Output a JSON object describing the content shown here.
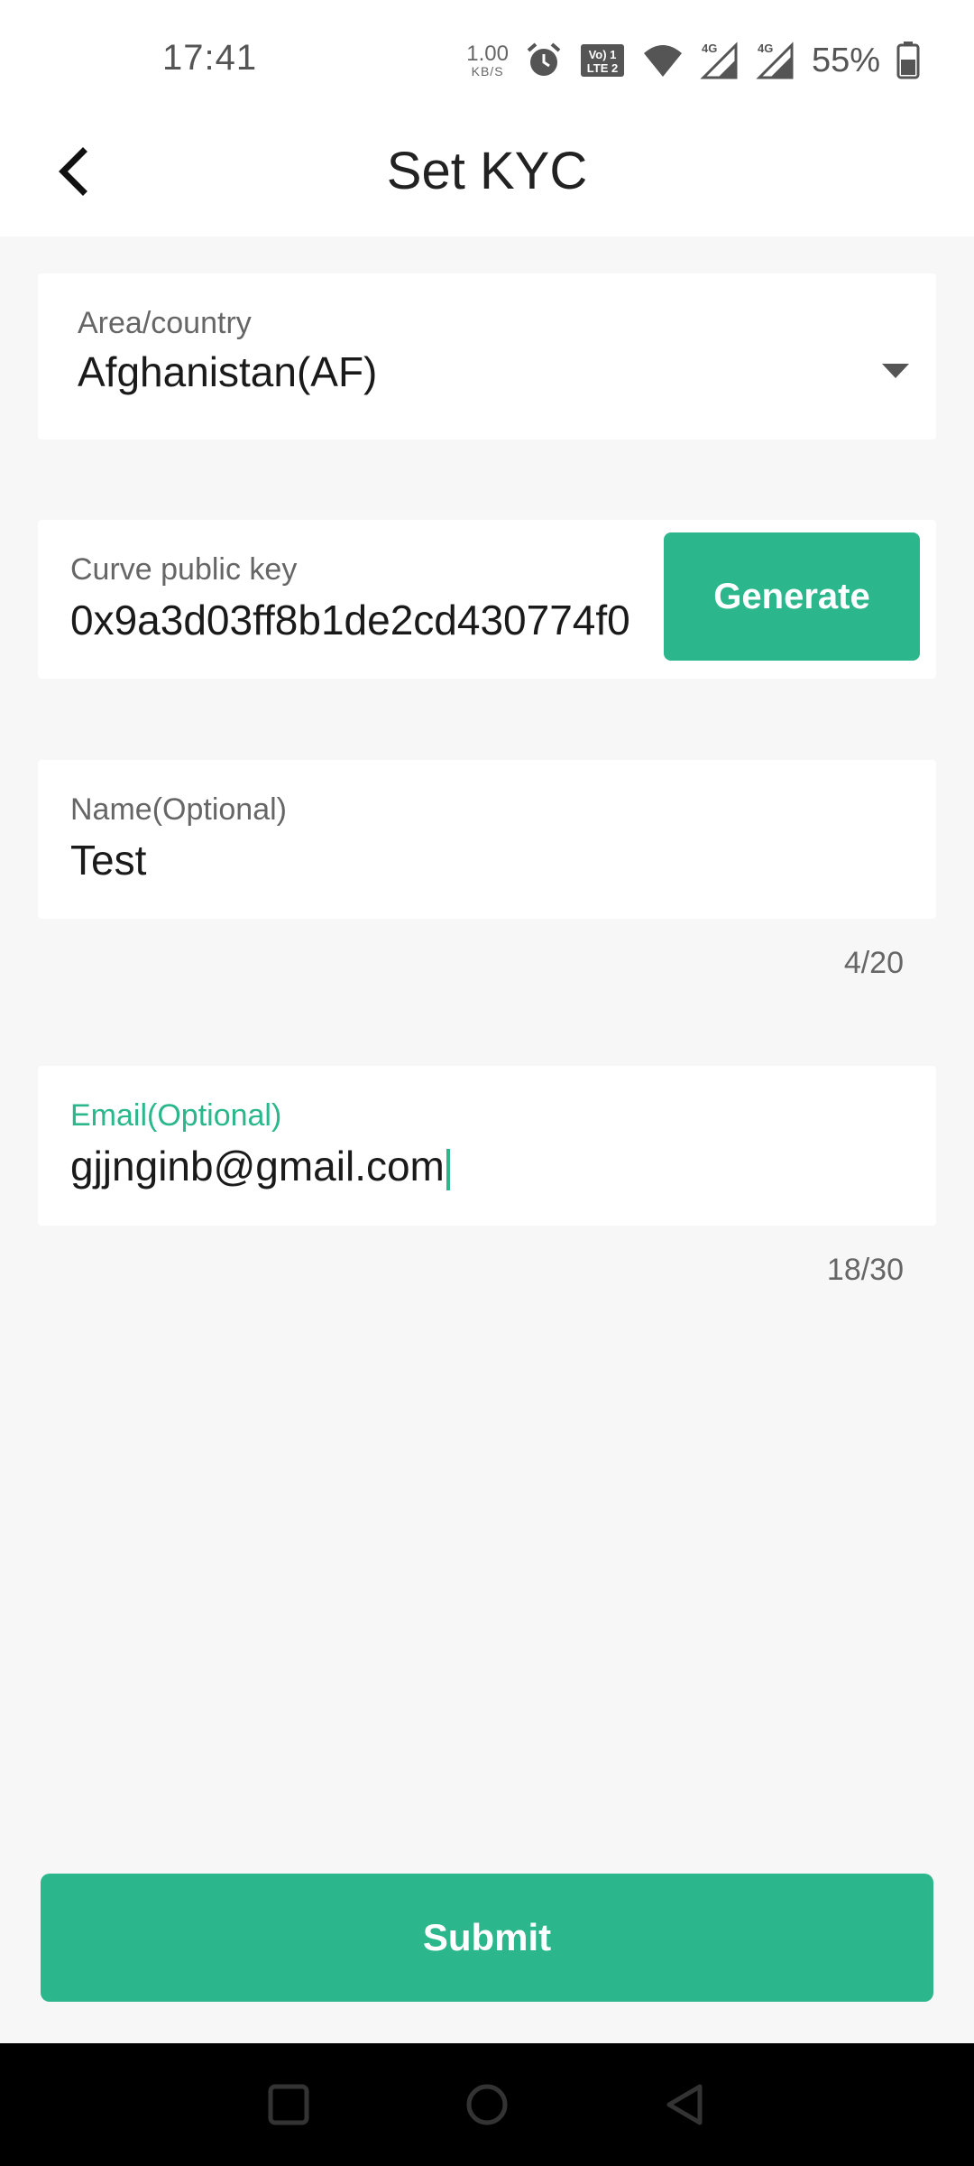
{
  "status_bar": {
    "time": "17:41",
    "net_speed_value": "1.00",
    "net_speed_unit": "KB/S",
    "volte_label": "Vo) 1 LTE 2",
    "signal_labels": [
      "4G",
      "4G"
    ],
    "battery": "55%",
    "icons": [
      "alarm-icon",
      "volte-icon",
      "wifi-icon",
      "signal-icon",
      "signal-icon",
      "battery-icon"
    ]
  },
  "header": {
    "title": "Set KYC",
    "back_icon": "chevron-left-icon"
  },
  "form": {
    "country": {
      "label": "Area/country",
      "value": "Afghanistan(AF)"
    },
    "public_key": {
      "label": "Curve public key",
      "value": "0x9a3d03ff8b1de2cd430774f0",
      "button": "Generate"
    },
    "name": {
      "label": "Name(Optional)",
      "value": "Test",
      "counter": "4/20"
    },
    "email": {
      "label": "Email(Optional)",
      "value": "gjjnginb@gmail.com",
      "counter": "18/30"
    },
    "submit": "Submit"
  },
  "colors": {
    "accent": "#2bb78b",
    "background": "#f7f7f7",
    "card": "#ffffff"
  }
}
